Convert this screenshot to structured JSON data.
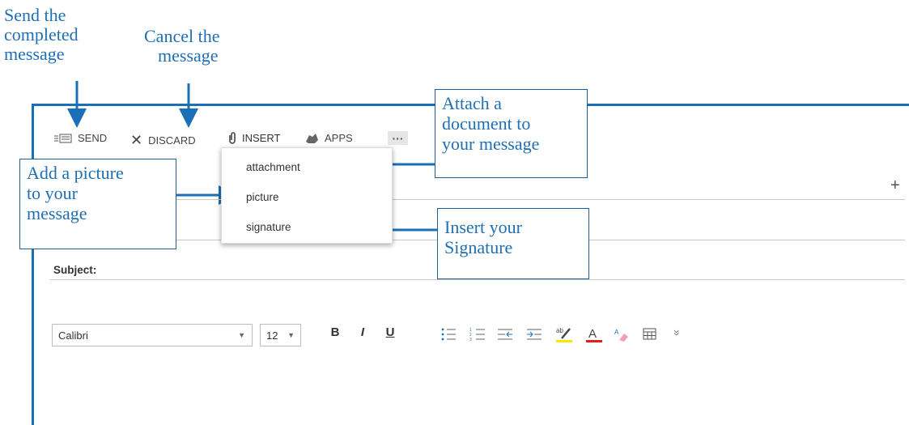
{
  "annotations": {
    "send": "Send the completed message",
    "send_lines": [
      "Send the",
      "completed",
      "message"
    ],
    "discard_lines": [
      "Cancel the",
      "message"
    ],
    "attach": [
      "Attach a",
      "document to",
      "your message"
    ],
    "picture": [
      "Add a picture",
      "to your",
      "message"
    ],
    "signature": [
      "Insert your",
      "Signature"
    ]
  },
  "toolbar": {
    "send_label": "SEND",
    "discard_label": "DISCARD",
    "insert_label": "INSERT",
    "apps_label": "APPS",
    "more_label": "···"
  },
  "insert_menu": {
    "items": [
      "attachment",
      "picture",
      "signature"
    ]
  },
  "compose": {
    "add_label": "+",
    "subject_label": "Subject:"
  },
  "format_bar": {
    "font": "Calibri",
    "size": "12",
    "bold": "B",
    "italic": "I",
    "underline": "U",
    "more": "»"
  },
  "colors": {
    "annotation": "#1f6fb2",
    "frame": "#1a6fb6",
    "highlight": "#ffe600",
    "font_color": "#e02020"
  }
}
